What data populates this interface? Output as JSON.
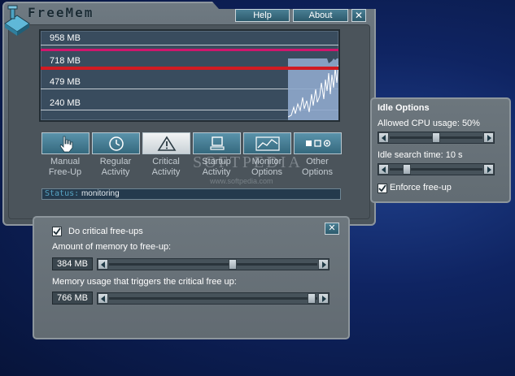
{
  "app": {
    "logo_text": "FreeMem"
  },
  "header": {
    "help_label": "Help",
    "about_label": "About",
    "close_glyph": "✕"
  },
  "graph": {
    "labels": [
      "958 MB",
      "718 MB",
      "479 MB",
      "240 MB"
    ],
    "colors": {
      "limit_pink": "#d0176d",
      "limit_red": "#d11b22",
      "usage_fill": "#8fa9cc"
    }
  },
  "modes": [
    {
      "line1": "Manual",
      "line2": "Free-Up",
      "icon": "hand-icon"
    },
    {
      "line1": "Regular",
      "line2": "Activity",
      "icon": "clock-icon"
    },
    {
      "line1": "Critical",
      "line2": "Activity",
      "icon": "warning-icon"
    },
    {
      "line1": "Startup",
      "line2": "Activity",
      "icon": "computer-icon"
    },
    {
      "line1": "Monitor",
      "line2": "Options",
      "icon": "chart-icon"
    },
    {
      "line1": "Other",
      "line2": "Options",
      "icon": "shapes-icon"
    }
  ],
  "watermark": {
    "text": "SOFTPEDIA",
    "url": "www.softpedia.com"
  },
  "status": {
    "key": "Status:",
    "value": "monitoring"
  },
  "idle": {
    "title": "Idle Options",
    "cpu_label": "Allowed CPU usage: 50%",
    "cpu_value_percent": 50,
    "search_label": "Idle search time: 10 s",
    "enforce_label": "Enforce free-up",
    "enforce_checked": true
  },
  "critical": {
    "enable_label": "Do critical free-ups",
    "enable_checked": true,
    "amount_label": "Amount of memory to free-up:",
    "amount_value": "384 MB",
    "trigger_label": "Memory usage that triggers the critical free up:",
    "trigger_value": "766 MB",
    "close_glyph": "✕"
  }
}
